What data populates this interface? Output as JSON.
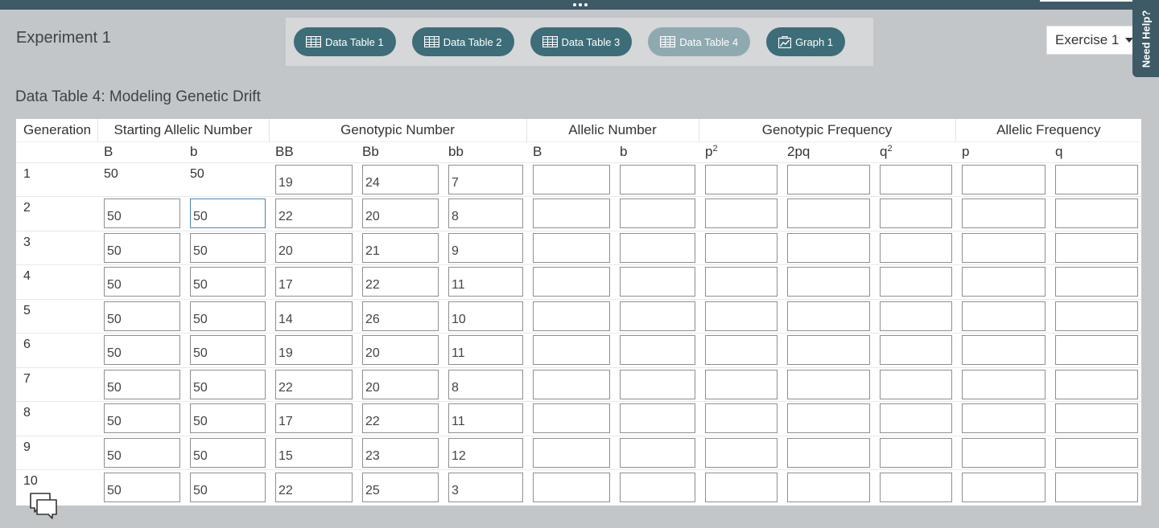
{
  "experiment": {
    "title": "Experiment 1"
  },
  "tabs": [
    {
      "label": "Data Table 1",
      "icon": "table-icon",
      "active": false
    },
    {
      "label": "Data Table 2",
      "icon": "table-icon",
      "active": false
    },
    {
      "label": "Data Table 3",
      "icon": "table-icon",
      "active": false
    },
    {
      "label": "Data Table 4",
      "icon": "table-icon",
      "active": true
    },
    {
      "label": "Graph 1",
      "icon": "graph-icon",
      "active": false
    }
  ],
  "exercise_select": {
    "value": "Exercise 1"
  },
  "help": {
    "label": "Need Help?"
  },
  "table": {
    "title": "Data Table 4: Modeling Genetic Drift",
    "group_headers": [
      "Generation",
      "Starting Allelic Number",
      "Genotypic Number",
      "Allelic Number",
      "Genotypic Frequency",
      "Allelic Frequency"
    ],
    "sub_headers": {
      "start_B": "B",
      "start_b": "b",
      "BB": "BB",
      "Bb": "Bb",
      "bb": "bb",
      "allelic_B": "B",
      "allelic_b": "b",
      "p_base": "p",
      "p_exp": "2",
      "two_pq": "2pq",
      "q_base": "q",
      "q_exp": "2",
      "p": "p",
      "q": "q"
    },
    "rows": [
      {
        "gen": "1",
        "start_B": "50",
        "start_b": "50",
        "BB": "19",
        "Bb": "24",
        "bb": "7"
      },
      {
        "gen": "2",
        "start_B": "50",
        "start_b": "50",
        "BB": "22",
        "Bb": "20",
        "bb": "8"
      },
      {
        "gen": "3",
        "start_B": "50",
        "start_b": "50",
        "BB": "20",
        "Bb": "21",
        "bb": "9"
      },
      {
        "gen": "4",
        "start_B": "50",
        "start_b": "50",
        "BB": "17",
        "Bb": "22",
        "bb": "11"
      },
      {
        "gen": "5",
        "start_B": "50",
        "start_b": "50",
        "BB": "14",
        "Bb": "26",
        "bb": "10"
      },
      {
        "gen": "6",
        "start_B": "50",
        "start_b": "50",
        "BB": "19",
        "Bb": "20",
        "bb": "11"
      },
      {
        "gen": "7",
        "start_B": "50",
        "start_b": "50",
        "BB": "22",
        "Bb": "20",
        "bb": "8"
      },
      {
        "gen": "8",
        "start_B": "50",
        "start_b": "50",
        "BB": "17",
        "Bb": "22",
        "bb": "11"
      },
      {
        "gen": "9",
        "start_B": "50",
        "start_b": "50",
        "BB": "15",
        "Bb": "23",
        "bb": "12"
      },
      {
        "gen": "10",
        "start_B": "50",
        "start_b": "50",
        "BB": "22",
        "Bb": "25",
        "bb": "3"
      }
    ]
  },
  "icons": {
    "chat": "chat-icon"
  },
  "colors": {
    "accent": "#3d6d78",
    "active_tab": "#8eaab0",
    "topbar": "#3d5a66",
    "background": "#c3c6c9"
  }
}
